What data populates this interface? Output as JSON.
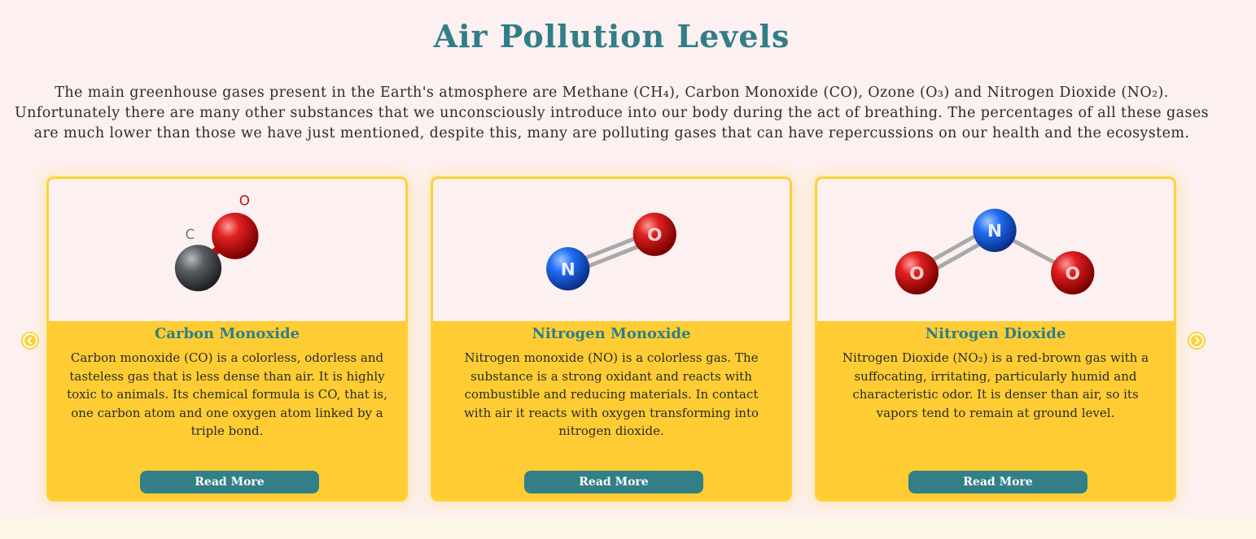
{
  "page": {
    "title": "Air Pollution Levels",
    "intro": "The main greenhouse gases present in the Earth's atmosphere are Methane (CH₄), Carbon Monoxide (CO), Ozone (O₃) and Nitrogen Dioxide (NO₂). Unfortunately there are many other substances that we unconsciously introduce into our body during the act of breathing. The percentages of all these gases are much lower than those we have just mentioned, despite this, many are polluting gases that can have repercussions on our health and the ecosystem."
  },
  "carousel": {
    "prev_icon": "chevron-left-icon",
    "next_icon": "chevron-right-icon",
    "cards": [
      {
        "title": "Carbon Monoxide",
        "text": "Carbon monoxide (CO) is a colorless, odorless and tasteless gas that is less dense than air. It is highly toxic to animals. Its chemical formula is CO, that is, one carbon atom and one oxygen atom linked by a triple bond.",
        "button": "Read More",
        "atoms": [
          "C",
          "O"
        ]
      },
      {
        "title": "Nitrogen Monoxide",
        "text": "Nitrogen monoxide (NO) is a colorless gas. The substance is a strong oxidant and reacts with combustible and reducing materials. In contact with air it reacts with oxygen transforming into nitrogen dioxide.",
        "button": "Read More",
        "atoms": [
          "N",
          "O"
        ]
      },
      {
        "title": "Nitrogen Dioxide",
        "text": "Nitrogen Dioxide (NO₂) is a red-brown gas with a suffocating, irritating, particularly humid and characteristic odor. It is denser than air, so its vapors tend to remain at ground level.",
        "button": "Read More",
        "atoms": [
          "O",
          "N",
          "O"
        ]
      }
    ]
  },
  "colors": {
    "background": "#fdf0f0",
    "accent_teal": "#2f7e88",
    "card_yellow": "#ffcd33",
    "button_teal": "#327f88"
  }
}
